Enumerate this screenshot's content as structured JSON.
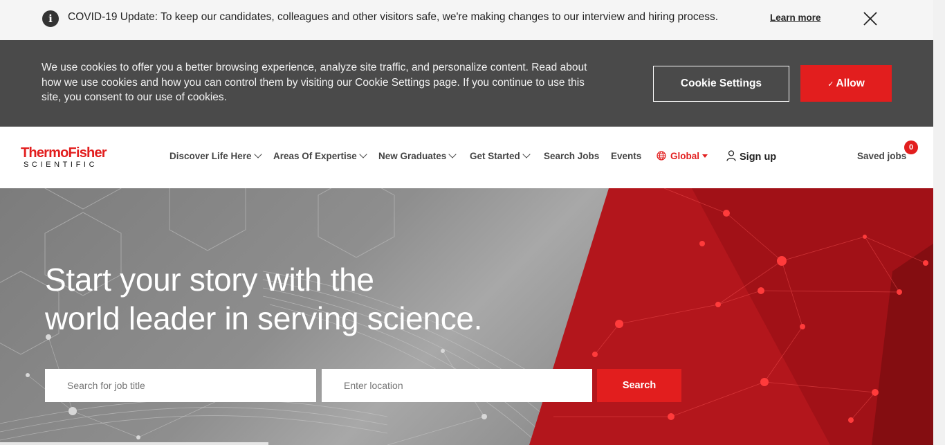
{
  "covid_banner": {
    "message": "COVID-19 Update: To keep our candidates, colleagues and other visitors safe, we're making changes to our interview and hiring process.",
    "learn_more": "Learn more"
  },
  "cookie_banner": {
    "text": "We use cookies to offer you a better browsing experience, analyze site traffic, and personalize content. Read about how we use cookies and how you can control them by visiting our Cookie Settings page. If you continue to use this site, you consent to our use of cookies.",
    "settings_label": "Cookie Settings",
    "allow_check": "✓",
    "allow_label": "Allow"
  },
  "header": {
    "logo_line1": "ThermoFisher",
    "logo_line2": "SCIENTIFIC",
    "nav": [
      {
        "label": "Discover Life Here"
      },
      {
        "label": "Areas Of Expertise"
      },
      {
        "label": "New Graduates"
      },
      {
        "label": "Get Started"
      },
      {
        "label": "Search Jobs"
      },
      {
        "label": "Events"
      }
    ],
    "global_label": "Global",
    "signup_label": "Sign up",
    "saved_jobs_label": "Saved jobs",
    "saved_jobs_count": "0"
  },
  "hero": {
    "headline_line1": "Start your story with the",
    "headline_line2": "world leader in serving science.",
    "job_title_placeholder": "Search for job title",
    "location_placeholder": "Enter location",
    "search_label": "Search"
  },
  "colors": {
    "brand_red": "#e21e1e",
    "cookie_bg": "#4a4a4a",
    "banner_bg": "#f5f5f5"
  }
}
